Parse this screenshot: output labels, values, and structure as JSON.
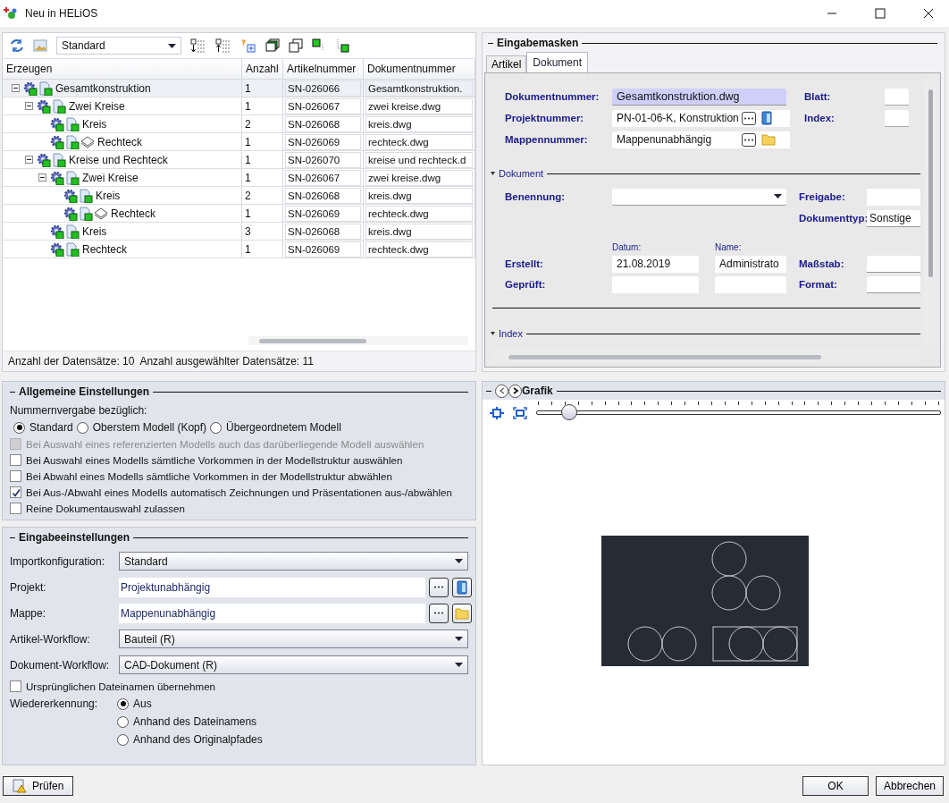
{
  "window": {
    "title": "Neu in HELiOS"
  },
  "tree_panel": {
    "view": "Standard",
    "columns": [
      "Erzeugen",
      "Anzahl",
      "Artikelnummer",
      "Dokumentnummer"
    ],
    "rows": [
      {
        "name": "Gesamtkonstruktion",
        "count": "1",
        "article": "SN-026066",
        "document": "Gesamtkonstruktion.",
        "selected": true,
        "layered": false,
        "expanded": true,
        "children": [
          {
            "name": "Zwei Kreise",
            "count": "1",
            "article": "SN-026067",
            "document": "zwei kreise.dwg",
            "selected": false,
            "layered": false,
            "expanded": true,
            "children": [
              {
                "name": "Kreis",
                "count": "2",
                "article": "SN-026068",
                "document": "kreis.dwg",
                "selected": false,
                "layered": false
              },
              {
                "name": "Rechteck",
                "count": "1",
                "article": "SN-026069",
                "document": "rechteck.dwg",
                "selected": false,
                "layered": true
              }
            ]
          },
          {
            "name": "Kreise und Rechteck",
            "count": "1",
            "article": "SN-026070",
            "document": "kreise und rechteck.d",
            "selected": false,
            "layered": false,
            "expanded": true,
            "children": [
              {
                "name": "Zwei Kreise",
                "count": "1",
                "article": "SN-026067",
                "document": "zwei kreise.dwg",
                "selected": false,
                "layered": false,
                "expanded": true,
                "children": [
                  {
                    "name": "Kreis",
                    "count": "2",
                    "article": "SN-026068",
                    "document": "kreis.dwg",
                    "selected": false,
                    "layered": false
                  },
                  {
                    "name": "Rechteck",
                    "count": "1",
                    "article": "SN-026069",
                    "document": "rechteck.dwg",
                    "selected": false,
                    "layered": true
                  }
                ]
              },
              {
                "name": "Kreis",
                "count": "3",
                "article": "SN-026068",
                "document": "kreis.dwg",
                "selected": false,
                "layered": false
              },
              {
                "name": "Rechteck",
                "count": "1",
                "article": "SN-026069",
                "document": "rechteck.dwg",
                "selected": false,
                "layered": false
              }
            ]
          }
        ]
      }
    ],
    "status": [
      "Anzahl der Datensätze: 10",
      "Anzahl ausgewählter Datensätze: 11"
    ]
  },
  "input_masks": {
    "title": "Eingabemasken",
    "tabs": [
      {
        "label": "Artikel",
        "selected": false
      },
      {
        "label": "Dokument",
        "selected": true
      }
    ],
    "header_fields": [
      {
        "label": "Dokumentnummer:",
        "value": "Gesamtkonstruktion.dwg",
        "kind": "highlighted"
      },
      {
        "label": "Projektnummer:",
        "value": "PN-01-06-K, Konstruktion",
        "kind": "project"
      },
      {
        "label": "Mappennummer:",
        "value": "Mappenunabhängig",
        "kind": "folder"
      }
    ],
    "side_fields": [
      {
        "label": "Blatt:"
      },
      {
        "label": "Index:"
      }
    ],
    "document_section": {
      "title": "Dokument",
      "name_label": "Benennung:",
      "release_label": "Freigabe:",
      "type_label": "Dokumenttyp:",
      "type_value": "Sonstige",
      "date_header": "Datum:",
      "name_header": "Name:",
      "created": {
        "label": "Erstellt:",
        "date": "21.08.2019",
        "name": "Administrato"
      },
      "checked": {
        "label": "Geprüft:"
      },
      "scale_label": "Maßstab:",
      "format_label": "Format:"
    },
    "index_section": {
      "title": "Index"
    }
  },
  "general_settings": {
    "title": "Allgemeine Einstellungen",
    "numbering_label": "Nummernvergabe bezüglich:",
    "numbering_options": [
      {
        "label": "Standard",
        "selected": true
      },
      {
        "label": "Oberstem Modell (Kopf)",
        "selected": false
      },
      {
        "label": "Übergeordnetem Modell",
        "selected": false
      }
    ],
    "options": [
      {
        "label": "Bei Auswahl eines referenzierten Modells auch das darüberliegende Modell auswählen",
        "checked": false,
        "disabled": true
      },
      {
        "label": "Bei Auswahl eines Modells sämtliche Vorkommen in der Modellstruktur auswählen",
        "checked": false,
        "disabled": false
      },
      {
        "label": "Bei Abwahl eines Modells sämtliche Vorkommen in der Modellstruktur abwählen",
        "checked": false,
        "disabled": false
      },
      {
        "label": "Bei Aus-/Abwahl eines Modells automatisch Zeichnungen und Präsentationen aus-/abwählen",
        "checked": true,
        "disabled": false
      },
      {
        "label": "Reine Dokumentauswahl zulassen",
        "checked": false,
        "disabled": false
      }
    ]
  },
  "input_settings": {
    "title": "Eingabeeinstellungen",
    "fields": [
      {
        "label": "Importkonfiguration:",
        "value": "Standard",
        "kind": "select"
      },
      {
        "label": "Projekt:",
        "value": "Projektunabhängig",
        "kind": "project"
      },
      {
        "label": "Mappe:",
        "value": "Mappenunabhängig",
        "kind": "folder"
      },
      {
        "label": "Artikel-Workflow:",
        "value": "Bauteil (R)",
        "kind": "select"
      },
      {
        "label": "Dokument-Workflow:",
        "value": "CAD-Dokument (R)",
        "kind": "select"
      }
    ],
    "keep_filename": {
      "label": "Ursprünglichen Dateinamen übernehmen",
      "checked": false
    },
    "recognition": {
      "label": "Wiedererkennung:",
      "options": [
        {
          "label": "Aus",
          "selected": true
        },
        {
          "label": "Anhand des Dateinamens",
          "selected": false
        },
        {
          "label": "Anhand des Originalpfades",
          "selected": false
        }
      ]
    }
  },
  "graphic": {
    "title": "Grafik",
    "zoom": {
      "level": 0.08
    }
  },
  "buttons": {
    "check": "Prüfen",
    "ok": "OK",
    "cancel": "Abbrechen"
  }
}
